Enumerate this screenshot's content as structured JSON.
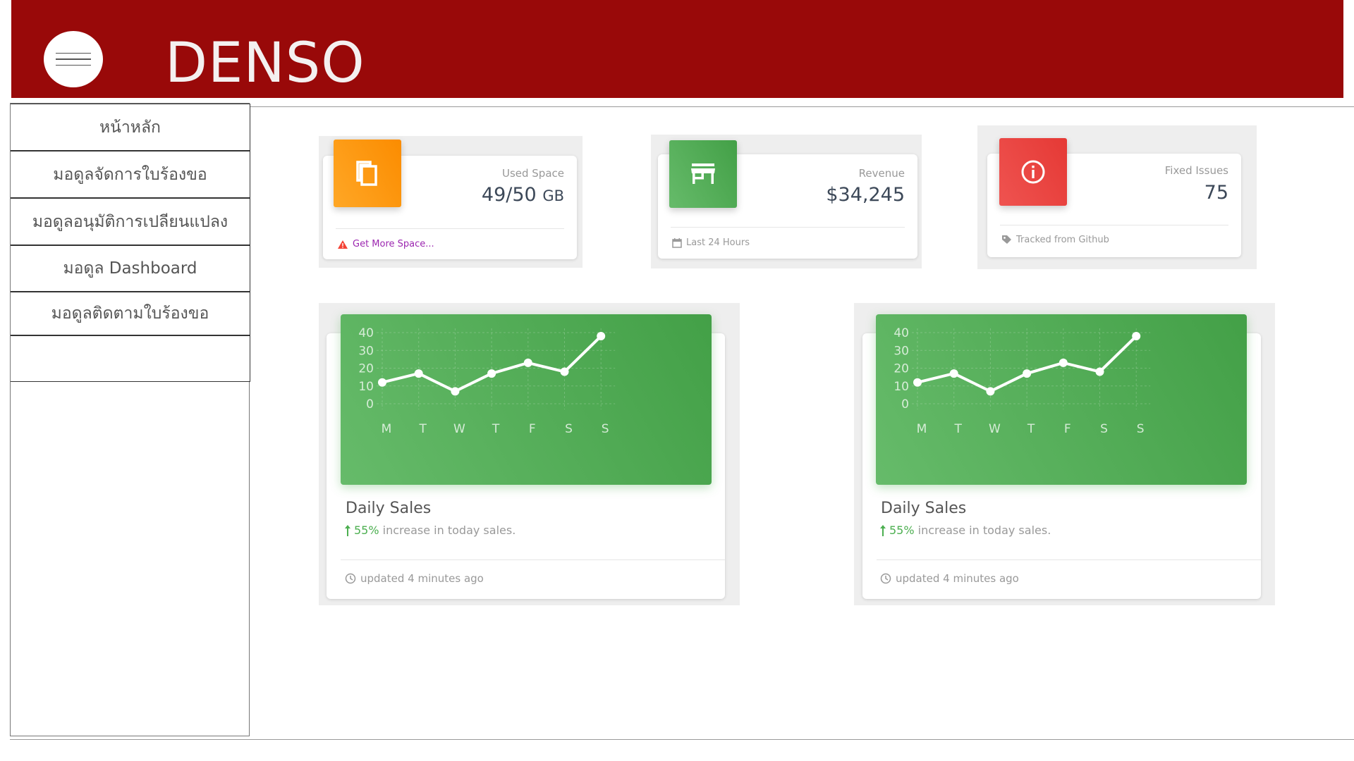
{
  "header": {
    "brand": "DENSO",
    "menu_icon": "hamburger-icon",
    "color": "#990909"
  },
  "sidebar": {
    "items": [
      {
        "label": "หน้าหลัก"
      },
      {
        "label": "มอดูลจัดการใบร้องขอ"
      },
      {
        "label": "มอดูลอนุมัติการเปลียนแปลง"
      },
      {
        "label": "มอดูล Dashboard"
      },
      {
        "label": "มอดูลติดตามใบร้องขอ"
      },
      {
        "label": ""
      }
    ]
  },
  "stats": [
    {
      "label": "Used Space",
      "value": "49/50",
      "unit": "GB",
      "footer": "Get More Space...",
      "icon": "copy-icon",
      "footer_icon": "warning-icon",
      "color": "#ffa21a",
      "footer_color": "#9c27b0"
    },
    {
      "label": "Revenue",
      "value": "$34,245",
      "footer": "Last 24 Hours",
      "icon": "store-icon",
      "footer_icon": "calendar-icon",
      "color": "#4caf50"
    },
    {
      "label": "Fixed Issues",
      "value": "75",
      "footer": "Tracked from Github",
      "icon": "info-icon",
      "footer_icon": "tag-icon",
      "color": "#f44336"
    }
  ],
  "charts": [
    {
      "title": "Daily Sales",
      "increase": "55%",
      "increase_text": " increase in today sales.",
      "updated": "updated 4 minutes ago"
    },
    {
      "title": "Daily Sales",
      "increase": "55%",
      "increase_text": " increase in today sales.",
      "updated": "updated 4 minutes ago"
    }
  ],
  "chart_data": [
    {
      "type": "line",
      "categories": [
        "M",
        "T",
        "W",
        "T",
        "F",
        "S",
        "S"
      ],
      "values": [
        12,
        17,
        7,
        17,
        23,
        18,
        38
      ],
      "yticks": [
        "40",
        "30",
        "20",
        "10",
        "0"
      ],
      "ylim": [
        0,
        40
      ],
      "grid": true,
      "color": "#ffffff"
    },
    {
      "type": "line",
      "categories": [
        "M",
        "T",
        "W",
        "T",
        "F",
        "S",
        "S"
      ],
      "values": [
        12,
        17,
        7,
        17,
        23,
        18,
        38
      ],
      "yticks": [
        "40",
        "30",
        "20",
        "10",
        "0"
      ],
      "ylim": [
        0,
        40
      ],
      "grid": true,
      "color": "#ffffff"
    }
  ]
}
